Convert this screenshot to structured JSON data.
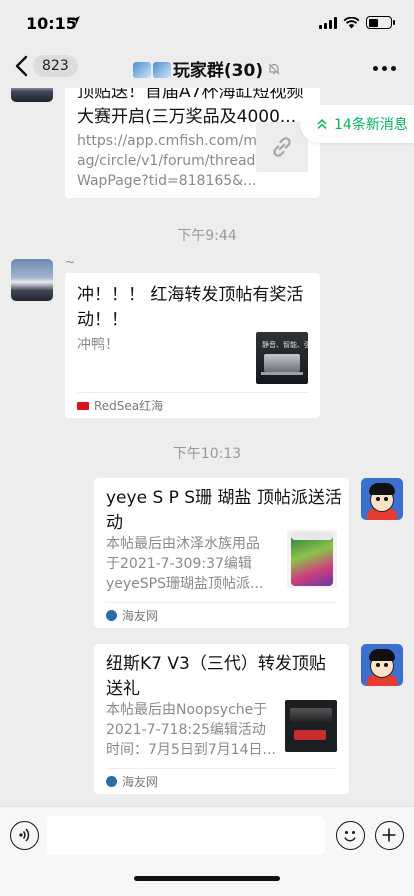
{
  "status": {
    "time": "10:15",
    "location_icon": "location-arrow-icon",
    "signal_icon": "signal-icon",
    "wifi_icon": "wifi-icon",
    "battery_icon": "battery-icon"
  },
  "nav": {
    "back_icon": "chevron-left-icon",
    "unread_count": "823",
    "title": "玩家群(30)",
    "mute_icon": "bell-off-icon",
    "more_icon": "more-dots-icon"
  },
  "new_messages": {
    "label": "14条新消息",
    "icon": "double-chevron-up-icon",
    "color": "#07b35a"
  },
  "messages": [
    {
      "side": "left",
      "title": "顶贴送！首届A7杯海缸短视频大赛开启(三万奖品及4000...",
      "title_lines": [
        "顶贴送！首届A7杯海缸短视频",
        "大赛开启(三万奖品及4000..."
      ],
      "desc_lines": [
        "https://app.cmfish.com/m",
        "ag/circle/v1/forum/thread",
        "WapPage?tid=818165&..."
      ],
      "thumb_icon": "link-icon"
    },
    {
      "side": "left",
      "timestamp": "下午9:44",
      "sender": "~",
      "title_lines": [
        "冲！！！ 红海转发顶帖有奖活",
        "动！！"
      ],
      "desc": "冲鸭！",
      "source": "RedSea红海",
      "thumb_text": "静音、智能、强劲"
    },
    {
      "side": "right",
      "timestamp": "下午10:13",
      "title_lines": [
        "yeye S P S珊 瑚盐 顶帖派送活",
        "动"
      ],
      "desc_lines": [
        "本帖最后由沐泽水族用品",
        "于2021-7-309:37编辑",
        "yeyeSPS珊瑚盐顶帖派..."
      ],
      "source": "海友网"
    },
    {
      "side": "right",
      "title_lines": [
        "纽斯K7 V3（三代）转发顶贴",
        "送礼"
      ],
      "desc_lines": [
        "本帖最后由Noopsyche于",
        "2021-7-718:25编辑活动",
        "时间：7月5日到7月14日..."
      ],
      "source": "海友网"
    }
  ],
  "input": {
    "voice_icon": "voice-icon",
    "emoji_icon": "emoji-icon",
    "plus_icon": "plus-icon"
  }
}
